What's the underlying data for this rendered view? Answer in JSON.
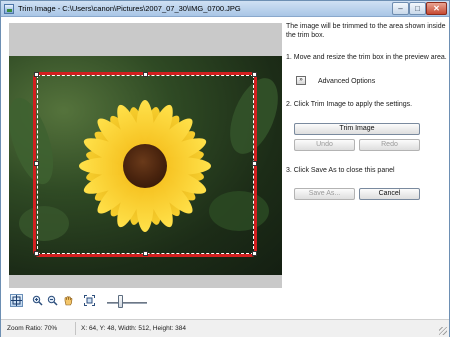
{
  "window": {
    "title": "Trim Image - C:\\Users\\canon\\Pictures\\2007_07_30\\IMG_0700.JPG",
    "buttons": {
      "minimize": "–",
      "maximize": "□",
      "close": "✕"
    }
  },
  "panel": {
    "intro": "The image will be trimmed to the area shown inside the trim box.",
    "step1": "1.  Move and resize the trim box in the preview area.",
    "advanced_icon": "»",
    "advanced_label": "Advanced Options",
    "step2": "2. Click Trim Image to apply the settings.",
    "trim_button": "Trim Image",
    "undo_button": "Undo",
    "redo_button": "Redo",
    "step3": "3. Click Save As to close this panel",
    "save_as_button": "Save As...",
    "cancel_button": "Cancel"
  },
  "toolbar": {
    "icons": [
      "trim-box-tool-icon",
      "zoom-in-icon",
      "zoom-out-icon",
      "hand-pan-icon",
      "fit-window-icon"
    ],
    "zoom_slider_value": 0.3
  },
  "status": {
    "zoom": "Zoom Ratio: 70%",
    "selection": "X: 64, Y: 48, Width: 512, Height: 384"
  },
  "colors": {
    "trim_box": "#d21f1f",
    "titlebar": "#a9c6e6"
  }
}
